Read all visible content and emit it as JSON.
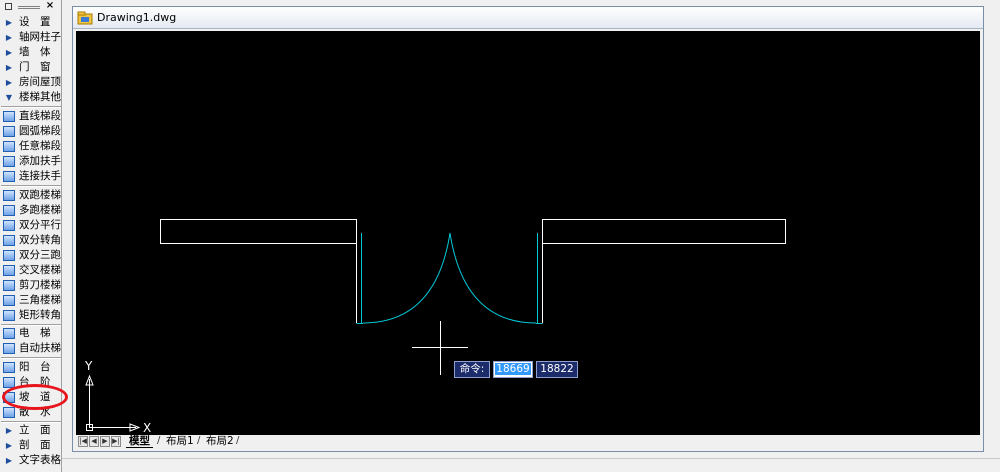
{
  "document": {
    "title": "Drawing1.dwg"
  },
  "palette": {
    "items": [
      {
        "label": "设　置",
        "icon": "expand-arrow-icon"
      },
      {
        "label": "轴网柱子",
        "icon": "expand-arrow-icon"
      },
      {
        "label": "墙　体",
        "icon": "expand-arrow-icon"
      },
      {
        "label": "门　窗",
        "icon": "expand-arrow-icon"
      },
      {
        "label": "房间屋顶",
        "icon": "expand-arrow-icon"
      },
      {
        "label": "楼梯其他",
        "icon": "collapse-arrow-icon"
      },
      {
        "label": "直线梯段",
        "icon": "straight-stair-icon"
      },
      {
        "label": "圆弧梯段",
        "icon": "arc-stair-icon"
      },
      {
        "label": "任意梯段",
        "icon": "free-stair-icon"
      },
      {
        "label": "添加扶手",
        "icon": "add-handrail-icon"
      },
      {
        "label": "连接扶手",
        "icon": "connect-handrail-icon"
      },
      {
        "label": "双跑楼梯",
        "icon": "double-run-stair-icon"
      },
      {
        "label": "多跑楼梯",
        "icon": "multi-run-stair-icon"
      },
      {
        "label": "双分平行",
        "icon": "double-parallel-stair-icon"
      },
      {
        "label": "双分转角",
        "icon": "double-corner-stair-icon"
      },
      {
        "label": "双分三跑",
        "icon": "double-three-run-stair-icon"
      },
      {
        "label": "交叉楼梯",
        "icon": "cross-stair-icon"
      },
      {
        "label": "剪刀楼梯",
        "icon": "scissor-stair-icon"
      },
      {
        "label": "三角楼梯",
        "icon": "triangle-stair-icon"
      },
      {
        "label": "矩形转角",
        "icon": "rect-corner-stair-icon"
      },
      {
        "label": "电　梯",
        "icon": "elevator-icon"
      },
      {
        "label": "自动扶梯",
        "icon": "escalator-icon"
      },
      {
        "label": "阳　台",
        "icon": "balcony-icon"
      },
      {
        "label": "台　阶",
        "icon": "steps-icon"
      },
      {
        "label": "坡　道",
        "icon": "ramp-icon"
      },
      {
        "label": "散　水",
        "icon": "apron-icon"
      },
      {
        "label": "立　面",
        "icon": "expand-arrow-icon"
      },
      {
        "label": "剖　面",
        "icon": "expand-arrow-icon"
      },
      {
        "label": "文字表格",
        "icon": "expand-arrow-icon"
      }
    ]
  },
  "command": {
    "prompt": "命令:",
    "x_value": "18669",
    "y_value": "18822"
  },
  "ucs": {
    "x_label": "X",
    "y_label": "Y"
  },
  "layout_tabs": [
    {
      "label": "模型",
      "active": true
    },
    {
      "label": "布局1",
      "active": false
    },
    {
      "label": "布局2",
      "active": false
    }
  ],
  "colors": {
    "canvas": "#000000",
    "geometry_white": "#ffffff",
    "geometry_cyan": "#00c8d8",
    "highlight": "#e8141c"
  }
}
